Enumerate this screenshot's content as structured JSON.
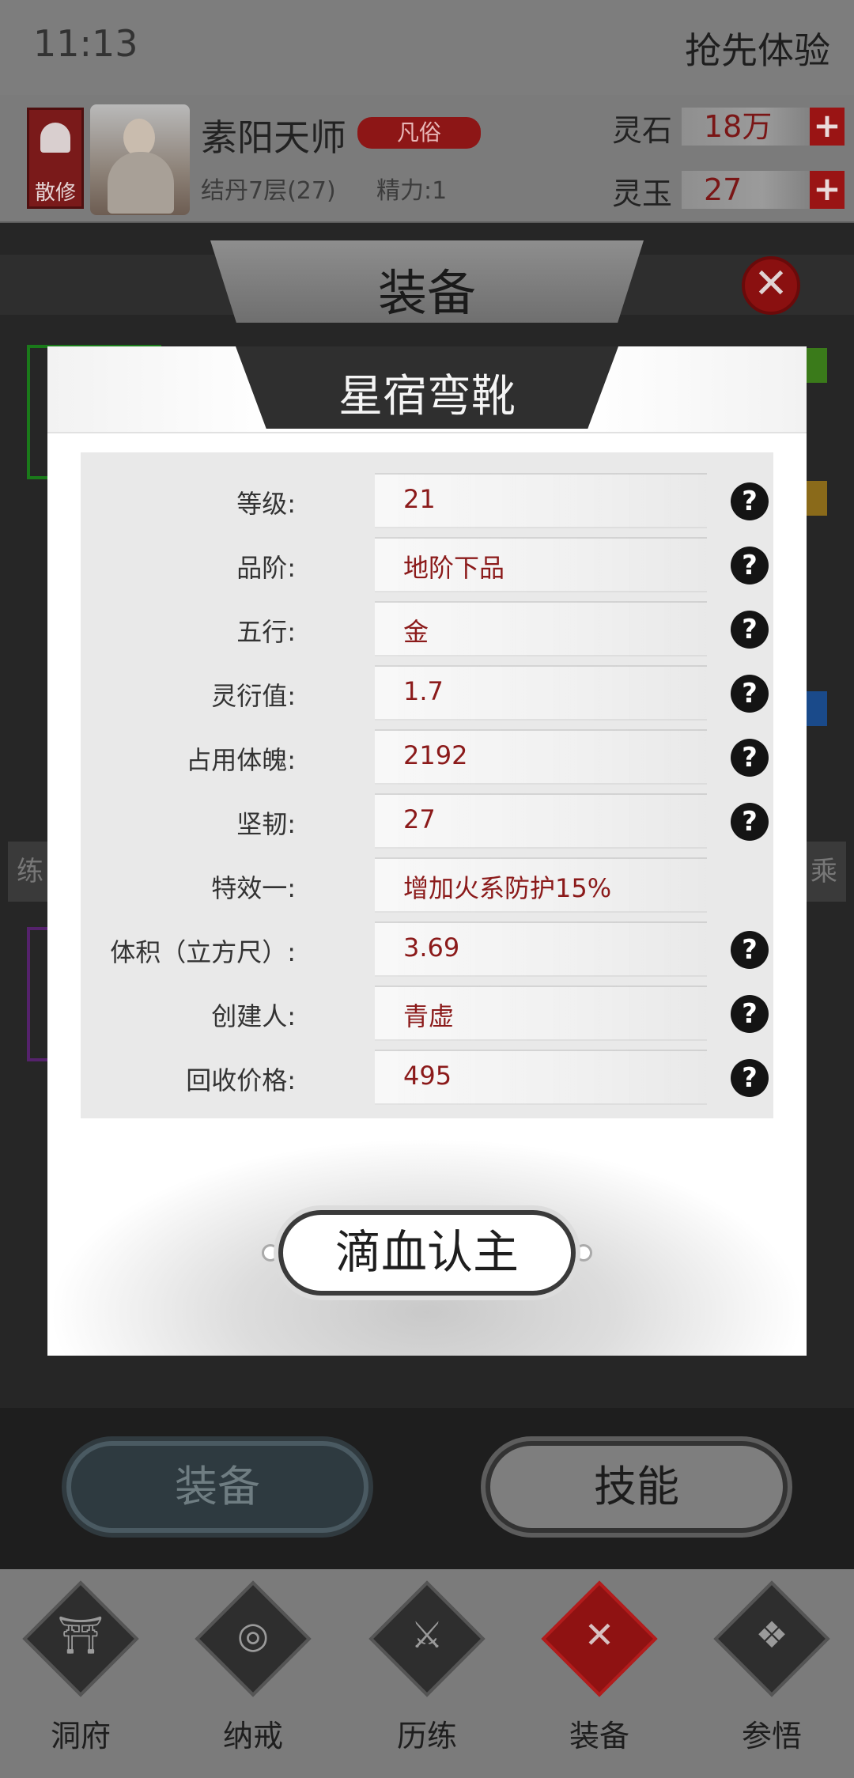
{
  "status": {
    "time": "11:13",
    "trial": "抢先体验"
  },
  "player": {
    "sect": "散修",
    "name": "素阳天师",
    "rank_tag": "凡俗",
    "realm": "结丹7层(27)",
    "energy": "精力:1",
    "currencies": [
      {
        "label": "灵石",
        "value": "18万",
        "plus": "+"
      },
      {
        "label": "灵玉",
        "value": "27",
        "plus": "+"
      }
    ]
  },
  "background": {
    "title": "装备",
    "close": "✕",
    "side_left": "练",
    "side_right": "乘"
  },
  "modal": {
    "title": "星宿弯靴",
    "rows": [
      {
        "label": "等级:",
        "value": "21",
        "help": "?"
      },
      {
        "label": "品阶:",
        "value": "地阶下品",
        "help": "?"
      },
      {
        "label": "五行:",
        "value": "金",
        "help": "?"
      },
      {
        "label": "灵衍值:",
        "value": "1.7",
        "help": "?"
      },
      {
        "label": "占用体魄:",
        "value": "2192",
        "help": "?"
      },
      {
        "label": "坚韧:",
        "value": "27",
        "help": "?"
      },
      {
        "label": "特效一:",
        "value": "增加火系防护15%",
        "help": ""
      },
      {
        "label": "体积（立方尺）:",
        "value": "3.69",
        "help": "?"
      },
      {
        "label": "创建人:",
        "value": "青虚",
        "help": "?"
      },
      {
        "label": "回收价格:",
        "value": "495",
        "help": "?"
      }
    ],
    "action": "滴血认主"
  },
  "bottom_buttons": {
    "equipment": "装备",
    "skills": "技能"
  },
  "nav": [
    {
      "label": "洞府",
      "icon": "cave-dwelling-icon",
      "glyph": "⛩"
    },
    {
      "label": "纳戒",
      "icon": "storage-ring-icon",
      "glyph": "◎"
    },
    {
      "label": "历练",
      "icon": "crossed-swords-icon",
      "glyph": "⚔"
    },
    {
      "label": "装备",
      "icon": "equipment-icon",
      "glyph": "✕",
      "active": true
    },
    {
      "label": "参悟",
      "icon": "open-book-icon",
      "glyph": "❖"
    }
  ],
  "colors": {
    "accent_red": "#8b1a1a",
    "modal_bg": "#ffffff",
    "dim_bg": "#262626"
  }
}
